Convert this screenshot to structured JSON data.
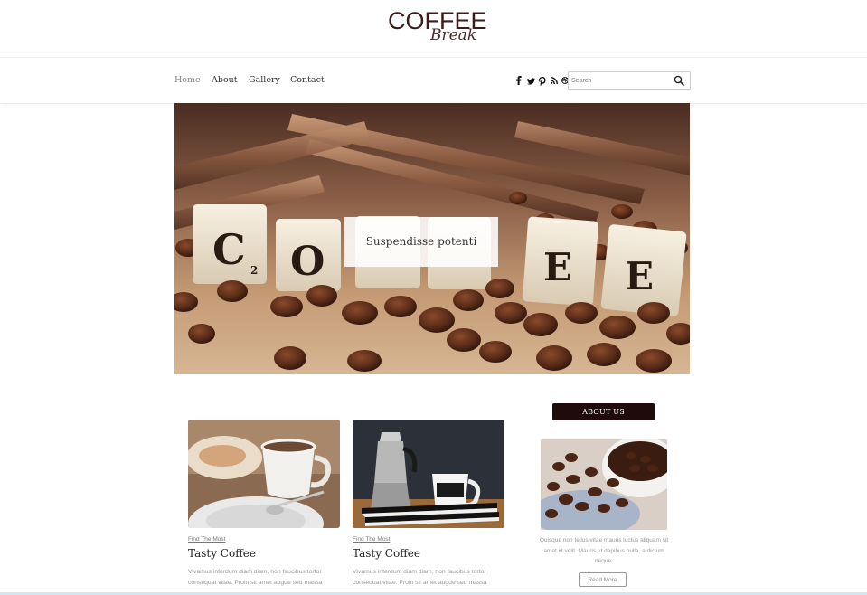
{
  "logo": {
    "main": "COFFEE",
    "sub": "Break"
  },
  "nav": {
    "items": [
      {
        "label": "Home",
        "active": true
      },
      {
        "label": "About"
      },
      {
        "label": "Gallery"
      },
      {
        "label": "Contact"
      }
    ]
  },
  "social": {
    "facebook": "f",
    "twitter": "twitter-icon",
    "pinterest": "pinterest-icon",
    "rss": "rss-icon",
    "dribbble": "dribbble-icon"
  },
  "search": {
    "placeholder": "Search"
  },
  "hero": {
    "caption": "Suspendisse potenti"
  },
  "posts": [
    {
      "category": "Find The Most",
      "title": "Tasty Coffee",
      "excerpt": "Vivamus interdum diam diam, non faucibus tortor consequat vitae. Proin sit amet augue sed massa"
    },
    {
      "category": "Find The Most",
      "title": "Tasty Coffee",
      "excerpt": "Vivamus interdum diam diam, non faucibus tortor consequat vitae. Proin sit amet augue sed massa"
    }
  ],
  "sidebar": {
    "heading": "ABOUT US",
    "text": "Quisque non tellus vitae mauris luctus aliquam sit amet id velit. Mauris ut dapibus nulla, a dictum neque.",
    "button": "Read More"
  },
  "colors": {
    "brand_dark": "#1f0a0c",
    "logo": "#3a1a1a"
  }
}
